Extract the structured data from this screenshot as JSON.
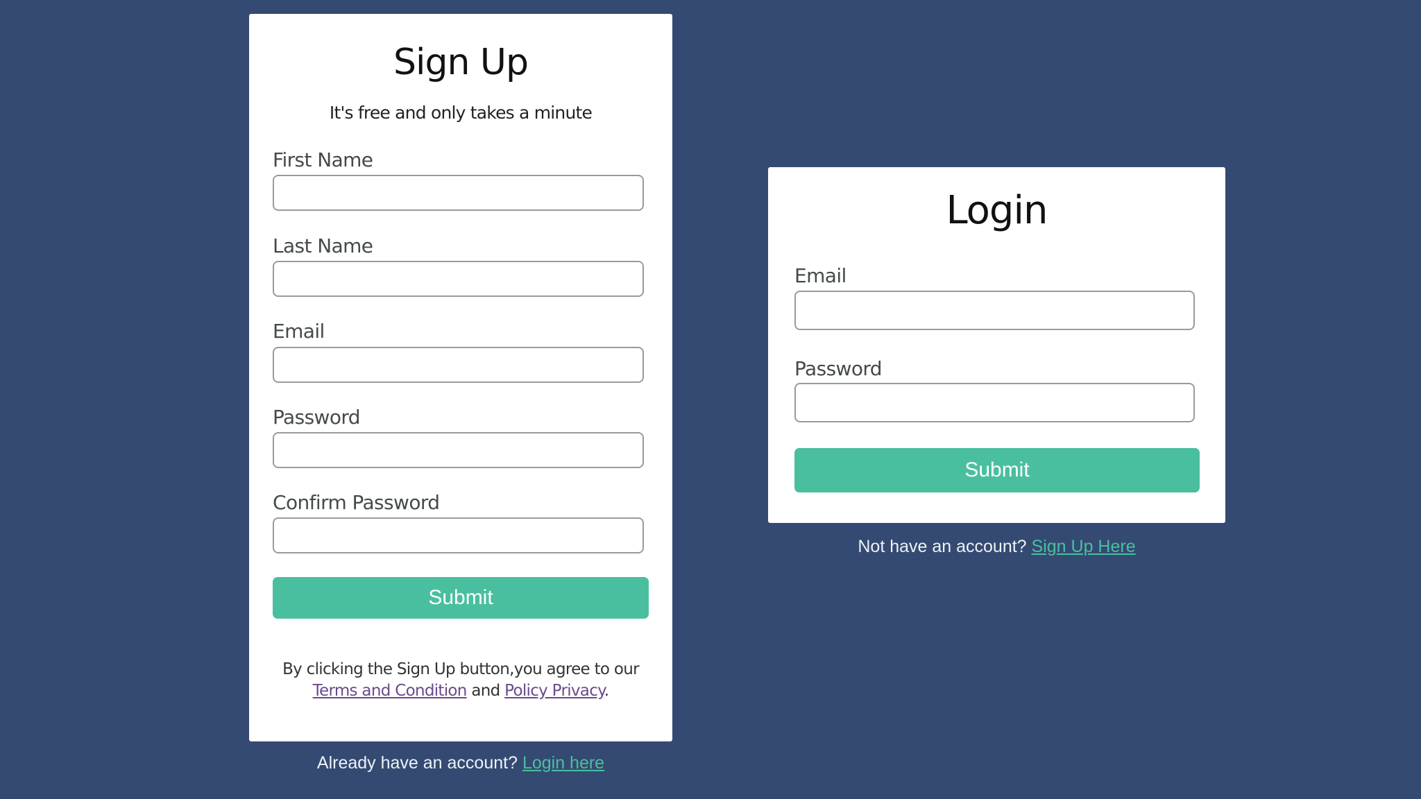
{
  "colors": {
    "background": "#344A72",
    "card": "#FFFFFF",
    "accent": "#4ABF9F",
    "terms_link": "#6B4A8C"
  },
  "signup": {
    "title": "Sign Up",
    "subtitle": "It's free and only takes a minute",
    "fields": [
      {
        "label": "First Name",
        "value": "",
        "placeholder": ""
      },
      {
        "label": "Last Name",
        "value": "",
        "placeholder": ""
      },
      {
        "label": "Email",
        "value": "",
        "placeholder": ""
      },
      {
        "label": "Password",
        "value": "",
        "placeholder": ""
      },
      {
        "label": "Confirm Password",
        "value": "",
        "placeholder": ""
      }
    ],
    "submit_label": "Submit",
    "terms": {
      "prefix": "By clicking the Sign Up button,you agree to our",
      "terms_link": "Terms and Condition",
      "conjunction": "and",
      "privacy_link": "Policy Privacy",
      "suffix": "."
    },
    "footer": {
      "text": "Already have an account?",
      "link": "Login here"
    }
  },
  "login": {
    "title": "Login",
    "fields": [
      {
        "label": "Email",
        "value": "",
        "placeholder": ""
      },
      {
        "label": "Password",
        "value": "",
        "placeholder": ""
      }
    ],
    "submit_label": "Submit",
    "footer": {
      "text": "Not have an account?",
      "link": "Sign Up Here"
    }
  }
}
